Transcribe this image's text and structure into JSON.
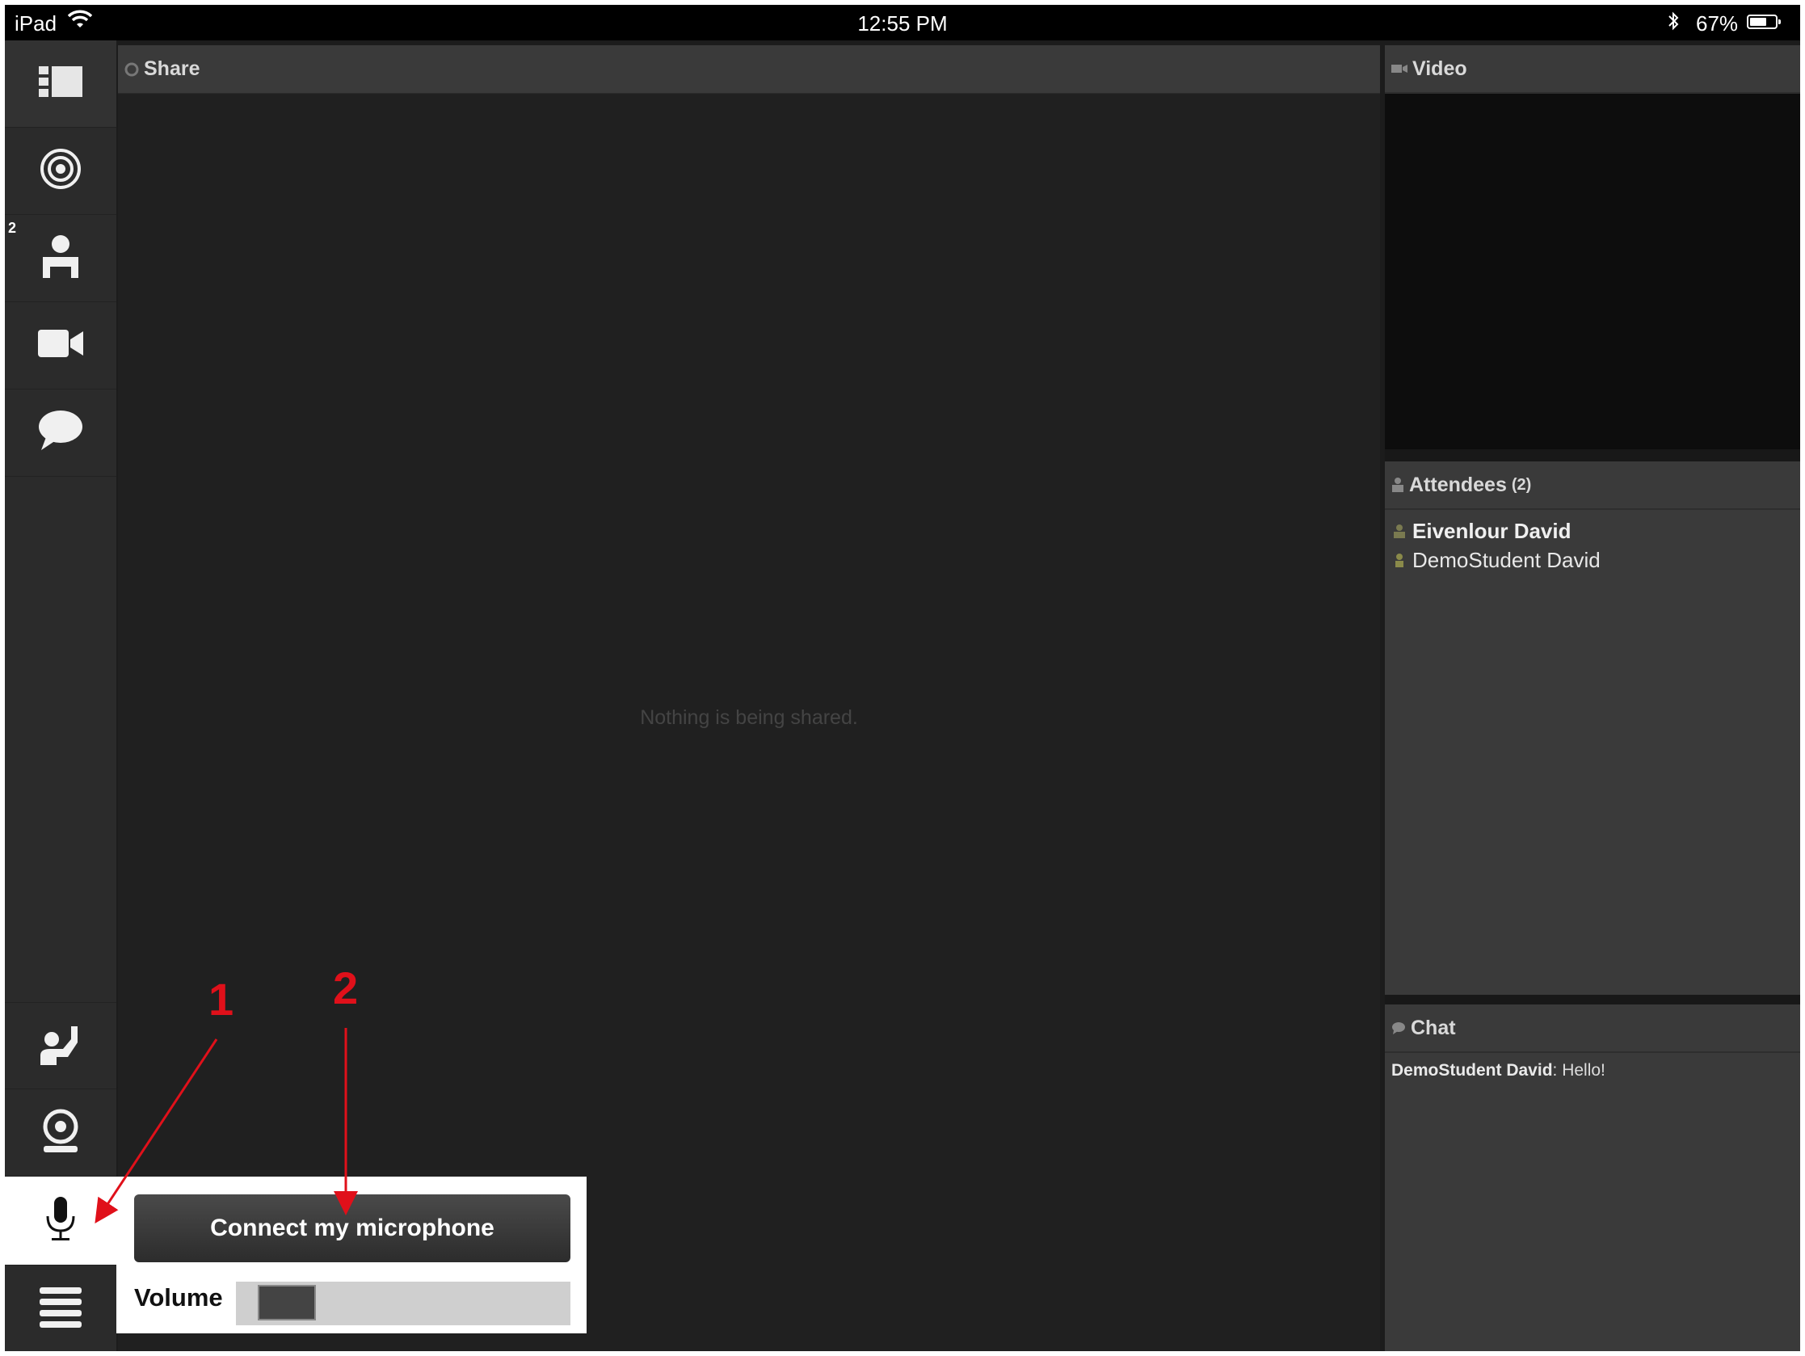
{
  "status_bar": {
    "device": "iPad",
    "time": "12:55 PM",
    "battery_percent": "67%",
    "battery_level": 0.67
  },
  "sidebar": {
    "items": [
      {
        "name": "layout",
        "icon": "layout-icon"
      },
      {
        "name": "share",
        "icon": "target-icon"
      },
      {
        "name": "attendees",
        "icon": "person-icon",
        "badge": "2"
      },
      {
        "name": "video",
        "icon": "video-camera-icon"
      },
      {
        "name": "chat",
        "icon": "chat-bubble-icon"
      },
      {
        "name": "raise-hand",
        "icon": "raise-hand-icon"
      },
      {
        "name": "webcam",
        "icon": "webcam-icon"
      },
      {
        "name": "microphone",
        "icon": "microphone-icon",
        "active": true
      },
      {
        "name": "menu",
        "icon": "hamburger-menu-icon"
      }
    ]
  },
  "share_panel": {
    "title": "Share",
    "empty_message": "Nothing is being shared."
  },
  "video_panel": {
    "title": "Video"
  },
  "attendees_panel": {
    "title": "Attendees",
    "count": "(2)",
    "attendees": [
      {
        "name": "Eivenlour David",
        "role": "host"
      },
      {
        "name": "DemoStudent David",
        "role": "participant"
      }
    ]
  },
  "chat_panel": {
    "title": "Chat",
    "messages": [
      {
        "sender": "DemoStudent David",
        "text": ": Hello!"
      }
    ]
  },
  "audio_popup": {
    "connect_label": "Connect my microphone",
    "volume_label": "Volume",
    "volume_level": 0.08
  },
  "annotations": {
    "marker_1": "1",
    "marker_2": "2",
    "arrow_color": "#e0101a"
  }
}
